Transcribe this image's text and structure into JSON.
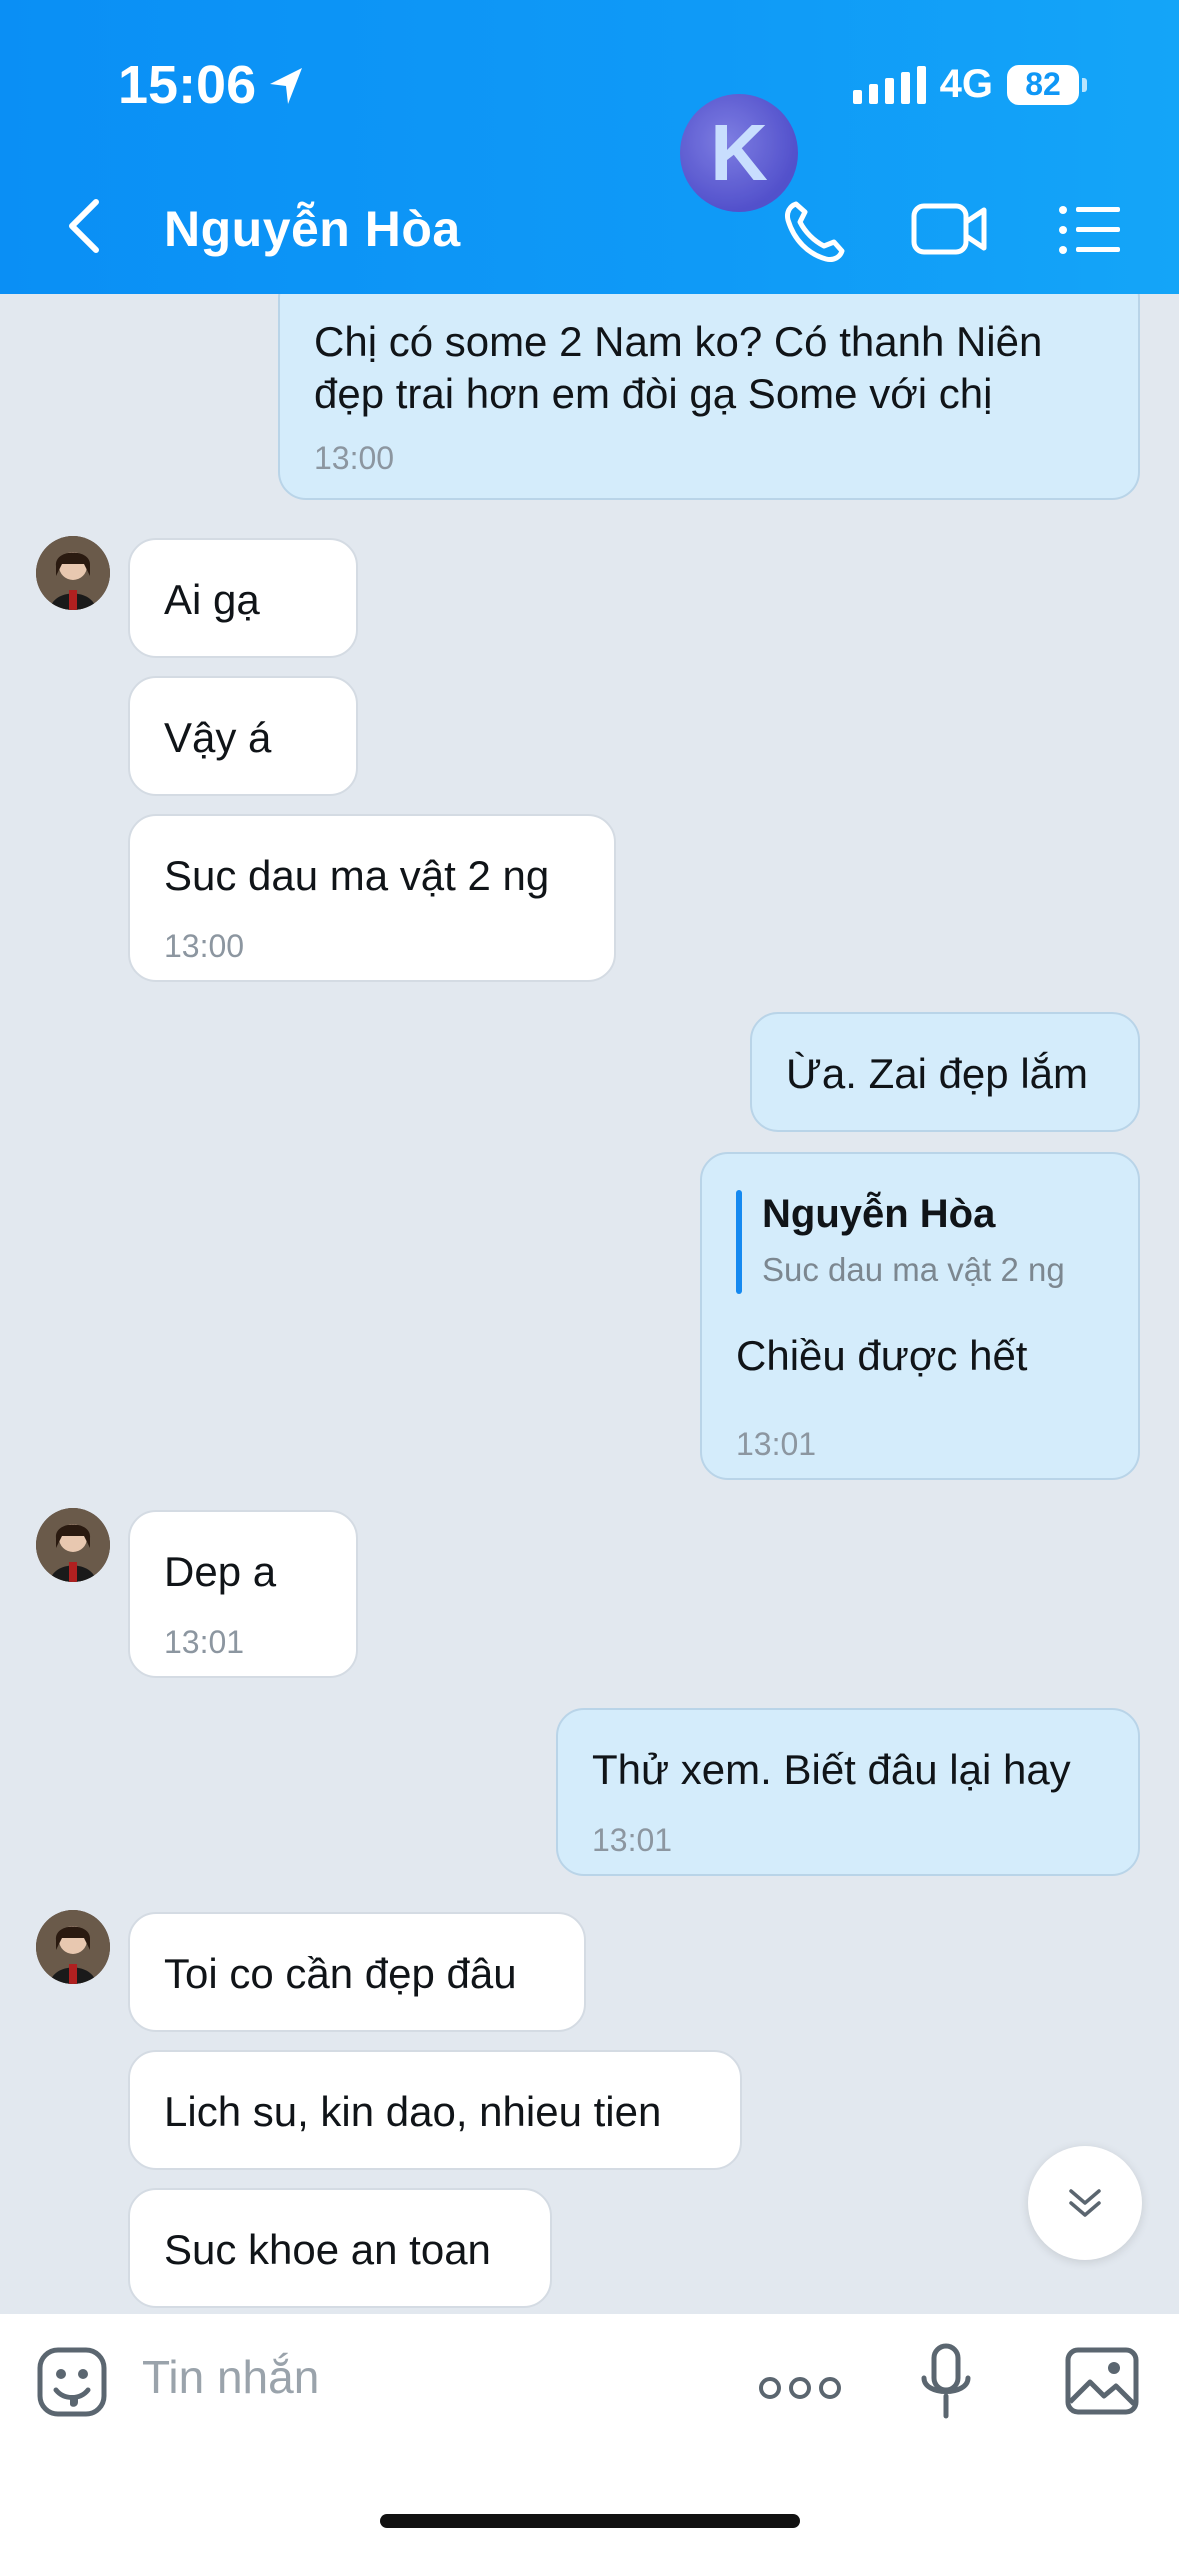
{
  "status_bar": {
    "time": "15:06",
    "network": "4G",
    "battery": "82"
  },
  "header": {
    "title": "Nguyễn Hòa",
    "logo_letter": "K"
  },
  "messages": [
    {
      "side": "out",
      "text_lines": [
        "Chị có some 2 Nam ko? Có thanh Niên",
        "đẹp trai hơn em đòi gạ Some với chị"
      ],
      "time": "13:00"
    },
    {
      "side": "in",
      "text": "Ai gạ"
    },
    {
      "side": "in",
      "text": "Vậy á"
    },
    {
      "side": "in",
      "text": "Suc dau ma vật 2 ng",
      "time": "13:00"
    },
    {
      "side": "out",
      "text": "Ừa. Zai đẹp lắm"
    },
    {
      "side": "out",
      "reply_to_name": "Nguyễn Hòa",
      "reply_to_text": "Suc dau ma vật 2 ng",
      "text": "Chiều được hết",
      "time": "13:01"
    },
    {
      "side": "in",
      "text": "Dep a",
      "time": "13:01"
    },
    {
      "side": "out",
      "text": "Thử xem. Biết đâu lại hay",
      "time": "13:01"
    },
    {
      "side": "in",
      "text": "Toi co cần đẹp đâu"
    },
    {
      "side": "in",
      "text": "Lich su, kin dao, nhieu tien"
    },
    {
      "side": "in",
      "text": "Suc khoe an toan"
    }
  ],
  "composer": {
    "placeholder": "Tin nhắn"
  }
}
